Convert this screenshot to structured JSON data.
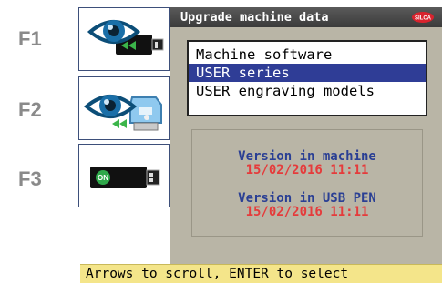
{
  "fkeys": [
    {
      "label": "F1",
      "icon": "eye-usb-icon"
    },
    {
      "label": "F2",
      "icon": "eye-key-machine-icon"
    },
    {
      "label": "F3",
      "icon": "usb-on-icon"
    }
  ],
  "f3_badge": "ON",
  "title": "Upgrade machine data",
  "logo_text": "SILCA",
  "menu": {
    "items": [
      "Machine software",
      "USER series",
      "USER engraving models"
    ],
    "selected_index": 1
  },
  "versions": {
    "machine_label": "Version in machine",
    "machine_value": "15/02/2016 11:11",
    "usb_label": "Version in USB PEN",
    "usb_value": "15/02/2016 11:11"
  },
  "status": "Arrows to scroll, ENTER to select",
  "colors": {
    "title_bg": "#444444",
    "screen_bg": "#b9b5a6",
    "selection": "#2f3d96",
    "label_blue": "#2a3f94",
    "value_red": "#e53b3b",
    "status_bg": "#f4e58a"
  }
}
